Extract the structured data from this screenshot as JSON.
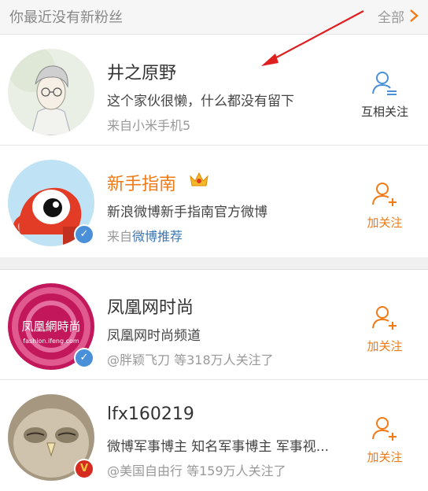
{
  "header": {
    "title": "你最近没有新粉丝",
    "all_label": "全部"
  },
  "colors": {
    "orange": "#f07a16",
    "blue": "#4a90d9",
    "vip_red": "#d62b1f",
    "annotation_red": "#e02020"
  },
  "users": [
    {
      "name": "井之原野",
      "desc": "这个家伙很懒，什么都没有留下",
      "source_prefix": "来自小米手机5",
      "source_link": "",
      "follow_label": "互相关注",
      "follow_icon": "mutual-follow-icon",
      "verified": false
    },
    {
      "name": "新手指南",
      "desc": "新浪微博新手指南官方微博",
      "source_prefix": "来自",
      "source_link": "微博推荐",
      "follow_label": "加关注",
      "follow_icon": "add-follow-icon",
      "verified": true,
      "badge": "✓"
    },
    {
      "name": "凤凰网时尚",
      "desc": "凤凰网时尚频道",
      "source_prefix": "@胖颖飞刀 等318万人关注了",
      "source_link": "",
      "follow_label": "加关注",
      "follow_icon": "add-follow-icon",
      "verified": true,
      "badge": "✓",
      "avatar_text": "凤凰網時尚",
      "avatar_subtext": "fashion.ifeng.com"
    },
    {
      "name": "lfx160219",
      "desc": "微博军事博主 知名军事博主 军事视...",
      "source_prefix": "@美国自由行 等159万人关注了",
      "source_link": "",
      "follow_label": "加关注",
      "follow_icon": "add-follow-icon",
      "verified": true,
      "badge": "V"
    }
  ]
}
